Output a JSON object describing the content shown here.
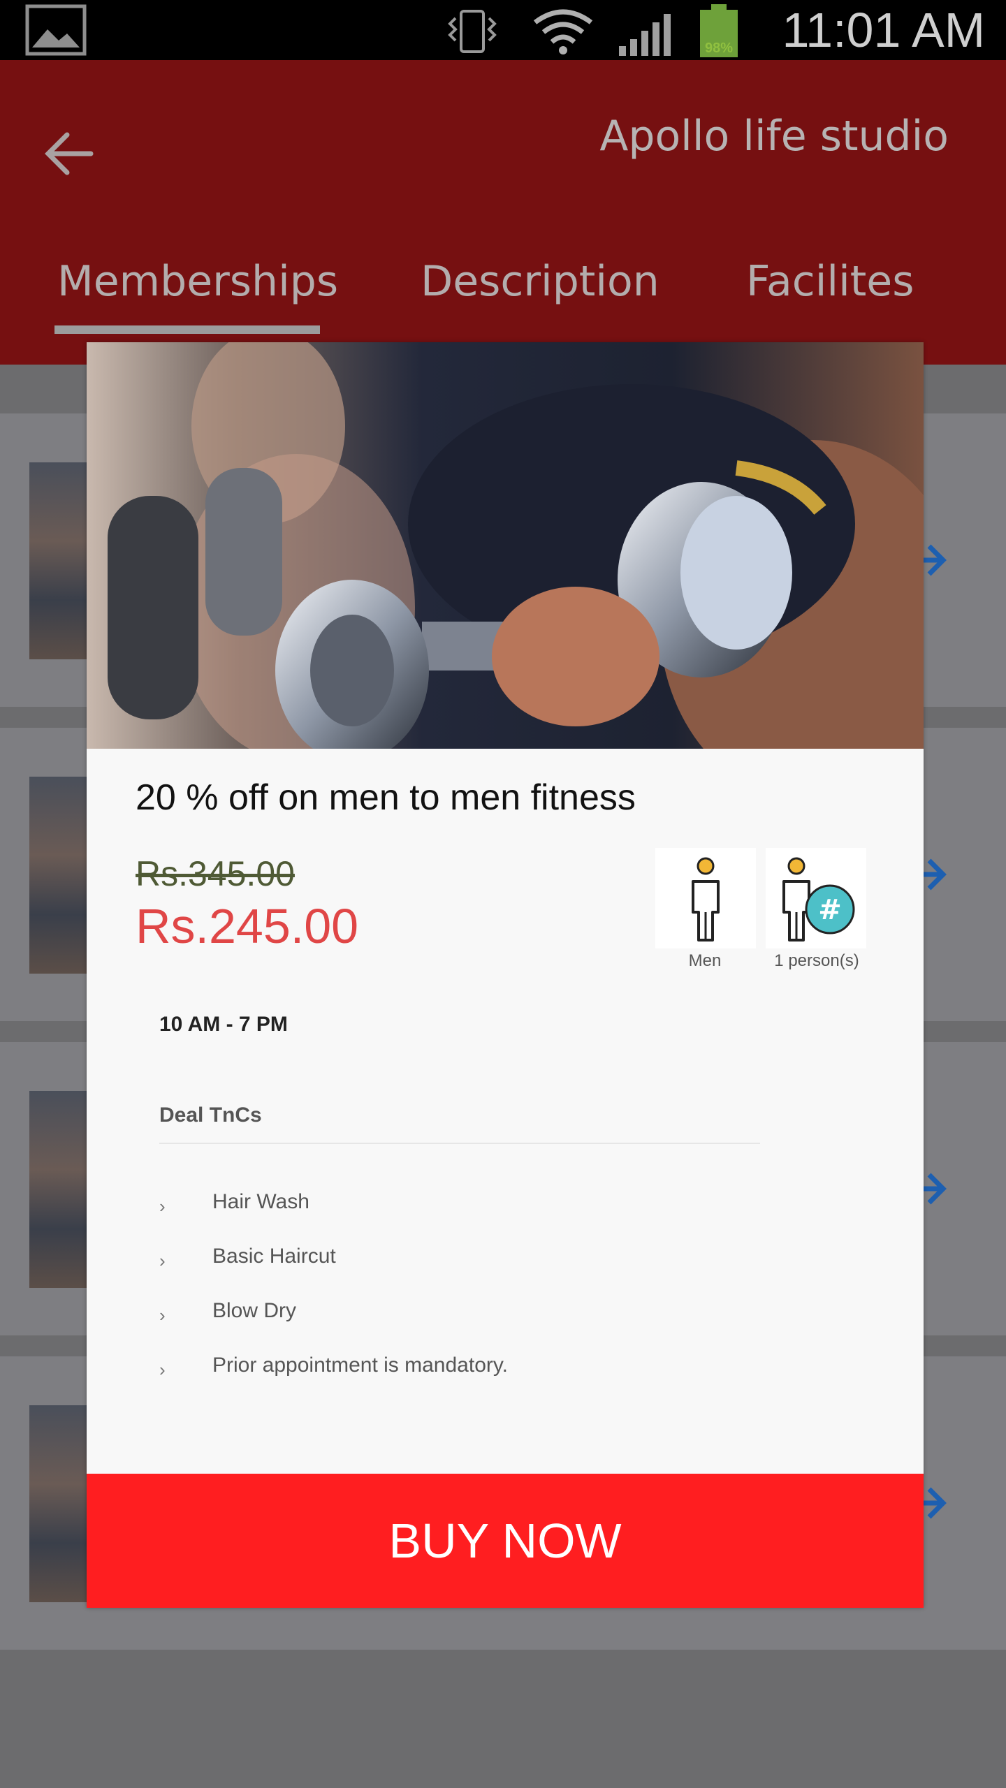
{
  "status_bar": {
    "time": "11:01 AM",
    "battery_label": "98%",
    "icons": [
      "gallery-icon",
      "vibrate-icon",
      "wifi-icon",
      "signal-icon",
      "battery-icon"
    ]
  },
  "header": {
    "title": "Apollo life studio",
    "back_icon": "arrow-left-icon"
  },
  "tabs": [
    {
      "label": "Memberships",
      "active": true
    },
    {
      "label": "Description",
      "active": false
    },
    {
      "label": "Facilites",
      "active": false
    }
  ],
  "modal": {
    "title": "20  % off on men to men fitness",
    "old_price": "Rs.345.00",
    "new_price": "Rs.245.00",
    "badges": [
      {
        "icon": "man-icon",
        "label": "Men"
      },
      {
        "icon": "person-count-icon",
        "label": "1 person(s)"
      }
    ],
    "timing": "10 AM - 7 PM",
    "tnc_heading": "Deal TnCs",
    "tnc_items": [
      "Hair Wash",
      "Basic Haircut",
      "Blow Dry",
      "Prior appointment is mandatory."
    ],
    "buy_label": "BUY NOW"
  },
  "colors": {
    "header_bg": "#761011",
    "buy_button": "#ff1e20",
    "new_price": "#e04646",
    "overlay_bg": "#6c6c6e"
  }
}
